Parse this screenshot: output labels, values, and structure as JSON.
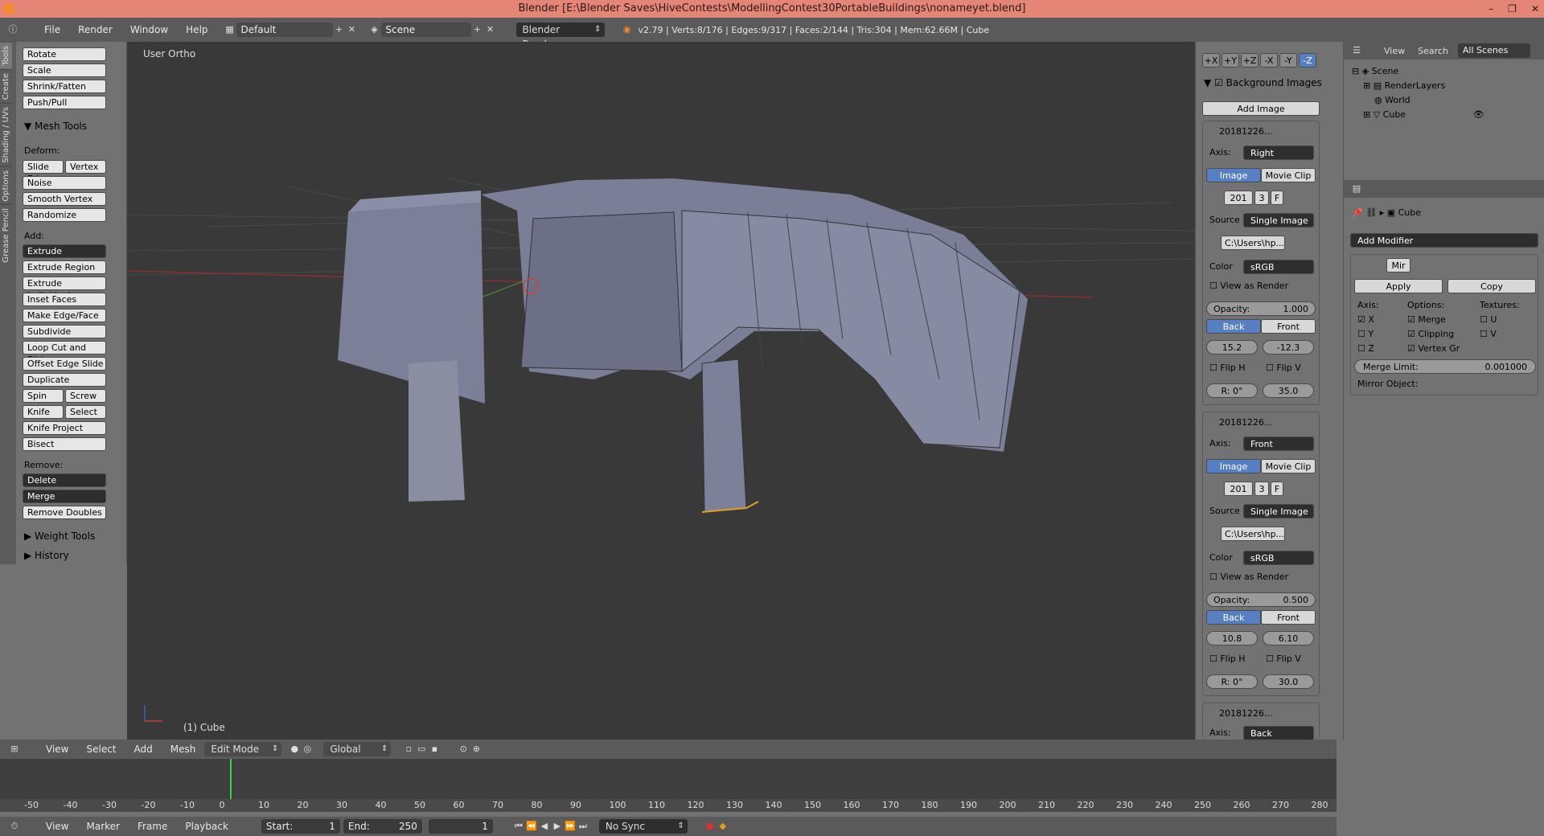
{
  "window": {
    "title": "Blender [E:\\Blender Saves\\HiveContests\\ModellingContest30PortableBuildings\\nonameyet.blend]"
  },
  "info": {
    "menus": [
      "File",
      "Render",
      "Window",
      "Help"
    ],
    "layout": "Default",
    "scene": "Scene",
    "engine": "Blender Render",
    "stats": "v2.79 | Verts:8/176 | Edges:9/317 | Faces:2/144 | Tris:304 | Mem:62.66M | Cube"
  },
  "lefttabs": [
    "Tools",
    "Create",
    "Shading / UVs",
    "Options",
    "Grease Pencil"
  ],
  "tools": {
    "top": [
      "Rotate",
      "Scale",
      "Shrink/Fatten",
      "Push/Pull"
    ],
    "mesh_tools": "Mesh Tools",
    "deform": "Deform:",
    "deform_items": [
      "Slide Ed",
      "Vertex",
      "Noise",
      "Smooth Vertex",
      "Randomize"
    ],
    "add": "Add:",
    "add_items": [
      "Extrude",
      "Extrude Region",
      "Extrude Individual",
      "Inset Faces",
      "Make Edge/Face",
      "Subdivide",
      "Loop Cut and Slide",
      "Offset Edge Slide",
      "Duplicate",
      "Spin",
      "Screw",
      "Knife",
      "Select",
      "Knife Project",
      "Bisect"
    ],
    "remove": "Remove:",
    "remove_items": [
      "Delete",
      "Merge",
      "Remove Doubles"
    ],
    "weight_tools": "Weight Tools",
    "history": "History"
  },
  "viewport": {
    "label": "User Ortho",
    "object": "(1) Cube"
  },
  "props": {
    "axis_buttons": [
      "+X",
      "+Y",
      "+Z",
      "-X",
      "-Y",
      "-Z"
    ],
    "bg_images": "Background Images",
    "add_image": "Add Image",
    "img1": {
      "name": "20181226...",
      "axis_label": "Axis:",
      "axis": "Right",
      "image": "Image",
      "movie": "Movie Clip",
      "frame": "201",
      "f3": "3",
      "f": "F",
      "source_label": "Source",
      "source": "Single Image",
      "path": "C:\\Users\\hp...",
      "color_label": "Color",
      "color": "sRGB",
      "view_render": "View as Render",
      "opacity": "Opacity:",
      "opacity_val": "1.000",
      "back": "Back",
      "front": "Front",
      "x": "15.2",
      "y": "-12.3",
      "fliph": "Flip H",
      "flipv": "Flip V",
      "rot": "R: 0°",
      "size": "35.0"
    },
    "img2": {
      "name": "20181226...",
      "axis_label": "Axis:",
      "axis": "Front",
      "image": "Image",
      "movie": "Movie Clip",
      "frame": "201",
      "f3": "3",
      "f": "F",
      "source_label": "Source",
      "source": "Single Image",
      "path": "C:\\Users\\hp...",
      "color_label": "Color",
      "color": "sRGB",
      "view_render": "View as Render",
      "opacity": "Opacity:",
      "opacity_val": "0.500",
      "back": "Back",
      "front": "Front",
      "x": "10.8",
      "y": "6.10",
      "fliph": "Flip H",
      "flipv": "Flip V",
      "rot": "R: 0°",
      "size": "30.0"
    },
    "img3": {
      "name": "20181226...",
      "axis_label": "Axis:",
      "axis": "Back"
    }
  },
  "outliner": {
    "view": "View",
    "search": "Search",
    "filter": "All Scenes",
    "rows": [
      "Scene",
      "RenderLayers",
      "World",
      "Cube"
    ]
  },
  "modifier": {
    "object": "Cube",
    "add": "Add Modifier",
    "name": "Mir",
    "apply": "Apply",
    "copy": "Copy",
    "axis": "Axis:",
    "options": "Options:",
    "textures": "Textures:",
    "x": "X",
    "y": "Y",
    "z": "Z",
    "merge": "Merge",
    "clipping": "Clipping",
    "vertexgr": "Vertex Gr",
    "u": "U",
    "v": "V",
    "merge_limit": "Merge Limit:",
    "merge_limit_val": "0.001000",
    "mirror_object": "Mirror Object:"
  },
  "vpheader": {
    "menus": [
      "View",
      "Select",
      "Add",
      "Mesh"
    ],
    "mode": "Edit Mode",
    "orientation": "Global"
  },
  "timeline": {
    "ticks": [
      "-50",
      "-40",
      "-30",
      "-20",
      "-10",
      "0",
      "10",
      "20",
      "30",
      "40",
      "50",
      "60",
      "70",
      "80",
      "90",
      "100",
      "110",
      "120",
      "130",
      "140",
      "150",
      "160",
      "170",
      "180",
      "190",
      "200",
      "210",
      "220",
      "230",
      "240",
      "250",
      "260",
      "270",
      "280"
    ],
    "menus": [
      "View",
      "Marker",
      "Frame",
      "Playback"
    ],
    "start_label": "Start:",
    "start": "1",
    "end_label": "End:",
    "end": "250",
    "current": "1",
    "sync": "No Sync"
  }
}
